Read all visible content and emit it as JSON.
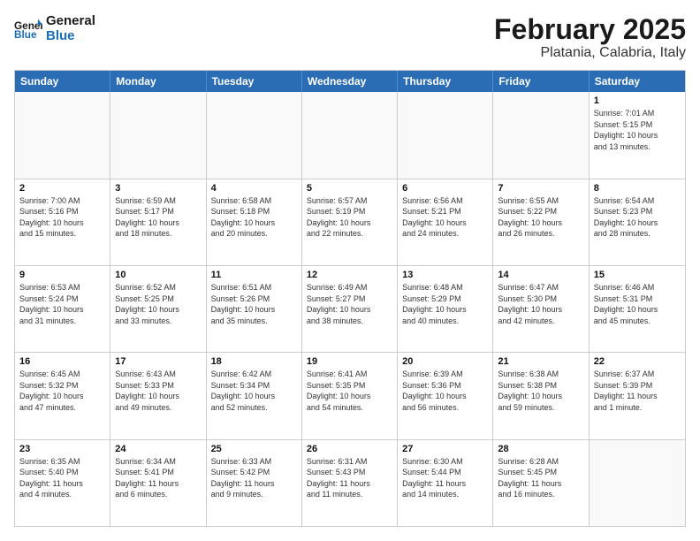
{
  "header": {
    "logo_general": "General",
    "logo_blue": "Blue",
    "month_title": "February 2025",
    "location": "Platania, Calabria, Italy"
  },
  "days_of_week": [
    "Sunday",
    "Monday",
    "Tuesday",
    "Wednesday",
    "Thursday",
    "Friday",
    "Saturday"
  ],
  "weeks": [
    [
      {
        "day": "",
        "info": ""
      },
      {
        "day": "",
        "info": ""
      },
      {
        "day": "",
        "info": ""
      },
      {
        "day": "",
        "info": ""
      },
      {
        "day": "",
        "info": ""
      },
      {
        "day": "",
        "info": ""
      },
      {
        "day": "1",
        "info": "Sunrise: 7:01 AM\nSunset: 5:15 PM\nDaylight: 10 hours\nand 13 minutes."
      }
    ],
    [
      {
        "day": "2",
        "info": "Sunrise: 7:00 AM\nSunset: 5:16 PM\nDaylight: 10 hours\nand 15 minutes."
      },
      {
        "day": "3",
        "info": "Sunrise: 6:59 AM\nSunset: 5:17 PM\nDaylight: 10 hours\nand 18 minutes."
      },
      {
        "day": "4",
        "info": "Sunrise: 6:58 AM\nSunset: 5:18 PM\nDaylight: 10 hours\nand 20 minutes."
      },
      {
        "day": "5",
        "info": "Sunrise: 6:57 AM\nSunset: 5:19 PM\nDaylight: 10 hours\nand 22 minutes."
      },
      {
        "day": "6",
        "info": "Sunrise: 6:56 AM\nSunset: 5:21 PM\nDaylight: 10 hours\nand 24 minutes."
      },
      {
        "day": "7",
        "info": "Sunrise: 6:55 AM\nSunset: 5:22 PM\nDaylight: 10 hours\nand 26 minutes."
      },
      {
        "day": "8",
        "info": "Sunrise: 6:54 AM\nSunset: 5:23 PM\nDaylight: 10 hours\nand 28 minutes."
      }
    ],
    [
      {
        "day": "9",
        "info": "Sunrise: 6:53 AM\nSunset: 5:24 PM\nDaylight: 10 hours\nand 31 minutes."
      },
      {
        "day": "10",
        "info": "Sunrise: 6:52 AM\nSunset: 5:25 PM\nDaylight: 10 hours\nand 33 minutes."
      },
      {
        "day": "11",
        "info": "Sunrise: 6:51 AM\nSunset: 5:26 PM\nDaylight: 10 hours\nand 35 minutes."
      },
      {
        "day": "12",
        "info": "Sunrise: 6:49 AM\nSunset: 5:27 PM\nDaylight: 10 hours\nand 38 minutes."
      },
      {
        "day": "13",
        "info": "Sunrise: 6:48 AM\nSunset: 5:29 PM\nDaylight: 10 hours\nand 40 minutes."
      },
      {
        "day": "14",
        "info": "Sunrise: 6:47 AM\nSunset: 5:30 PM\nDaylight: 10 hours\nand 42 minutes."
      },
      {
        "day": "15",
        "info": "Sunrise: 6:46 AM\nSunset: 5:31 PM\nDaylight: 10 hours\nand 45 minutes."
      }
    ],
    [
      {
        "day": "16",
        "info": "Sunrise: 6:45 AM\nSunset: 5:32 PM\nDaylight: 10 hours\nand 47 minutes."
      },
      {
        "day": "17",
        "info": "Sunrise: 6:43 AM\nSunset: 5:33 PM\nDaylight: 10 hours\nand 49 minutes."
      },
      {
        "day": "18",
        "info": "Sunrise: 6:42 AM\nSunset: 5:34 PM\nDaylight: 10 hours\nand 52 minutes."
      },
      {
        "day": "19",
        "info": "Sunrise: 6:41 AM\nSunset: 5:35 PM\nDaylight: 10 hours\nand 54 minutes."
      },
      {
        "day": "20",
        "info": "Sunrise: 6:39 AM\nSunset: 5:36 PM\nDaylight: 10 hours\nand 56 minutes."
      },
      {
        "day": "21",
        "info": "Sunrise: 6:38 AM\nSunset: 5:38 PM\nDaylight: 10 hours\nand 59 minutes."
      },
      {
        "day": "22",
        "info": "Sunrise: 6:37 AM\nSunset: 5:39 PM\nDaylight: 11 hours\nand 1 minute."
      }
    ],
    [
      {
        "day": "23",
        "info": "Sunrise: 6:35 AM\nSunset: 5:40 PM\nDaylight: 11 hours\nand 4 minutes."
      },
      {
        "day": "24",
        "info": "Sunrise: 6:34 AM\nSunset: 5:41 PM\nDaylight: 11 hours\nand 6 minutes."
      },
      {
        "day": "25",
        "info": "Sunrise: 6:33 AM\nSunset: 5:42 PM\nDaylight: 11 hours\nand 9 minutes."
      },
      {
        "day": "26",
        "info": "Sunrise: 6:31 AM\nSunset: 5:43 PM\nDaylight: 11 hours\nand 11 minutes."
      },
      {
        "day": "27",
        "info": "Sunrise: 6:30 AM\nSunset: 5:44 PM\nDaylight: 11 hours\nand 14 minutes."
      },
      {
        "day": "28",
        "info": "Sunrise: 6:28 AM\nSunset: 5:45 PM\nDaylight: 11 hours\nand 16 minutes."
      },
      {
        "day": "",
        "info": ""
      }
    ]
  ]
}
